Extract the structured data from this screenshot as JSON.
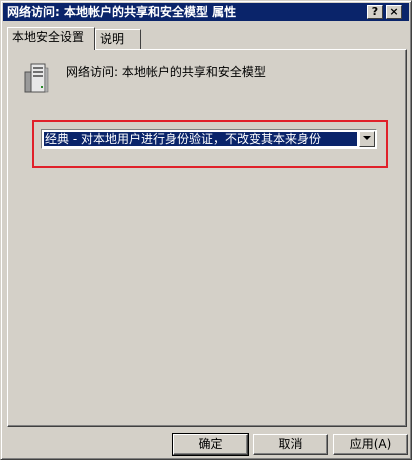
{
  "window": {
    "title": "网络访问: 本地帐户的共享和安全模型 属性",
    "help_label": "?",
    "close_label": "×"
  },
  "tabs": [
    {
      "label": "本地安全设置",
      "selected": true
    },
    {
      "label": "说明",
      "selected": false
    }
  ],
  "policy": {
    "icon": "server-icon",
    "name": "网络访问: 本地帐户的共享和安全模型"
  },
  "dropdown": {
    "selected": "经典 - 对本地用户进行身份验证，不改变其本来身份"
  },
  "buttons": {
    "ok": "确定",
    "cancel": "取消",
    "apply": "应用(A)"
  },
  "colors": {
    "titlebar": "#0a246a",
    "selection": "#0a246a",
    "highlight_annotation": "#e0202a",
    "face": "#d4d0c8"
  }
}
